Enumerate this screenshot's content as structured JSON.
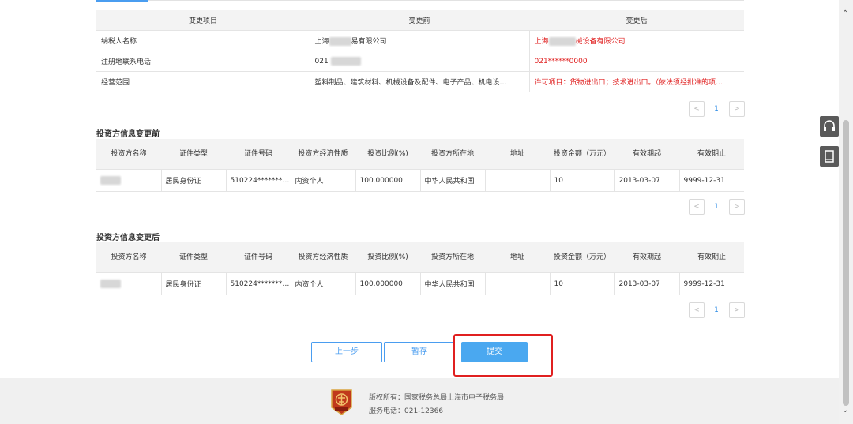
{
  "change_table": {
    "headers": [
      "变更项目",
      "变更前",
      "变更后"
    ],
    "rows": [
      {
        "item": "纳税人名称",
        "before": "上海",
        "before_suffix": "易有限公司",
        "after": "上海",
        "after_suffix": "械设备有限公司"
      },
      {
        "item": "注册地联系电话",
        "before": "021",
        "before_suffix": "",
        "after": "021******0000",
        "after_suffix": ""
      },
      {
        "item": "经营范围",
        "before": "塑料制品、建筑材料、机械设备及配件、电子产品、机电设…",
        "before_suffix": "",
        "after": "许可项目：货物进出口；技术进出口。（依法须经批准的项…",
        "after_suffix": ""
      }
    ]
  },
  "pagination": {
    "prev": "<",
    "page": "1",
    "next": ">"
  },
  "investor_before": {
    "title": "投资方信息变更前",
    "headers": [
      "投资方名称",
      "证件类型",
      "证件号码",
      "投资方经济性质",
      "投资比例(%)",
      "投资方所在地",
      "地址",
      "投资金额（万元）",
      "有效期起",
      "有效期止"
    ],
    "row": {
      "name": "",
      "id_type": "居民身份证",
      "id_no": "510224*******…",
      "nature": "内资个人",
      "ratio": "100.000000",
      "location": "中华人民共和国",
      "address": "",
      "amount": "10",
      "start": "2013-03-07",
      "end": "9999-12-31"
    }
  },
  "investor_after": {
    "title": "投资方信息变更后",
    "headers": [
      "投资方名称",
      "证件类型",
      "证件号码",
      "投资方经济性质",
      "投资比例(%)",
      "投资方所在地",
      "地址",
      "投资金额（万元）",
      "有效期起",
      "有效期止"
    ],
    "row": {
      "name": "",
      "id_type": "居民身份证",
      "id_no": "510224*******…",
      "nature": "内资个人",
      "ratio": "100.000000",
      "location": "中华人民共和国",
      "address": "",
      "amount": "10",
      "start": "2013-03-07",
      "end": "9999-12-31"
    }
  },
  "buttons": {
    "prev": "上一步",
    "save": "暂存",
    "submit": "提交"
  },
  "footer": {
    "copyright": "版权所有：国家税务总局上海市电子税务局",
    "phone": "服务电话：021-12366"
  },
  "colors": {
    "accent": "#4a9df0",
    "highlight": "#e02020",
    "changed_text": "#e02020"
  }
}
